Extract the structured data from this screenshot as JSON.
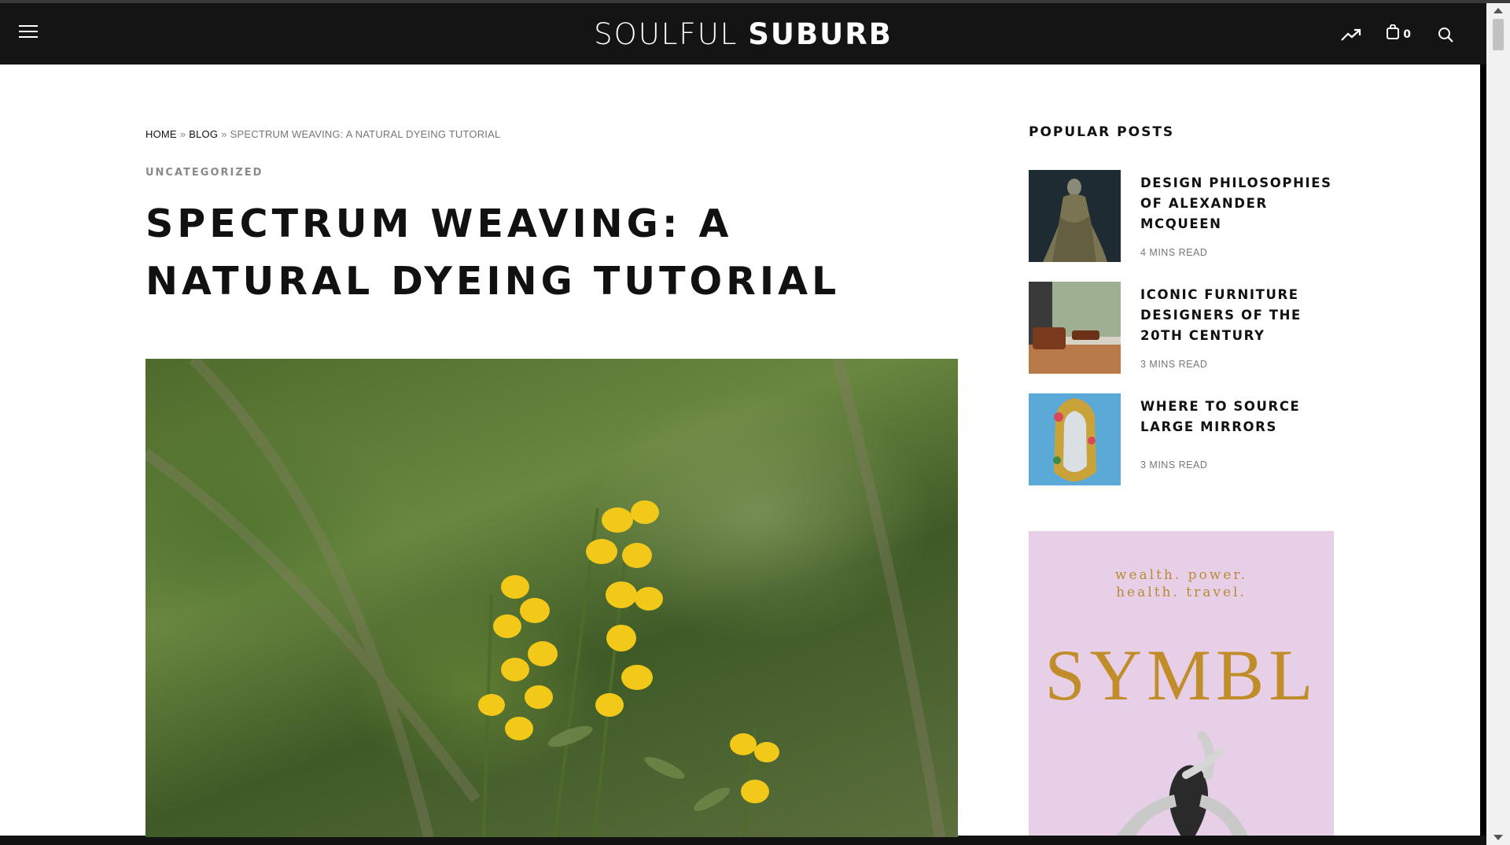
{
  "header": {
    "logo_light": "SOULFUL",
    "logo_bold": "SUBURB",
    "cart_count": "0",
    "icons": [
      "menu-icon",
      "trending-icon",
      "cart-icon",
      "search-icon"
    ]
  },
  "breadcrumb": {
    "home": "HOME",
    "sep1": "»",
    "blog": "BLOG",
    "sep2": "»",
    "current": "SPECTRUM WEAVING: A NATURAL DYEING TUTORIAL"
  },
  "post": {
    "category": "UNCATEGORIZED",
    "title": "SPECTRUM WEAVING: A NATURAL DYEING TUTORIAL"
  },
  "sidebar": {
    "title": "POPULAR POSTS",
    "posts": [
      {
        "title": "DESIGN PHILOSOPHIES OF ALEXANDER MCQUEEN",
        "meta": "4 MINS READ"
      },
      {
        "title": "ICONIC FURNITURE DESIGNERS OF THE 20TH CENTURY",
        "meta": "3 MINS READ"
      },
      {
        "title": "WHERE TO SOURCE LARGE MIRRORS",
        "meta": "3 MINS READ"
      }
    ]
  },
  "ad": {
    "tagline_line1": "wealth. power.",
    "tagline_line2": "health. travel.",
    "brand": "SYMBL"
  },
  "colors": {
    "header_bg": "#141414",
    "ad_bg": "#e7cfe8",
    "ad_gold": "#c08d2a",
    "mirror_blue": "#5aa9d6"
  }
}
